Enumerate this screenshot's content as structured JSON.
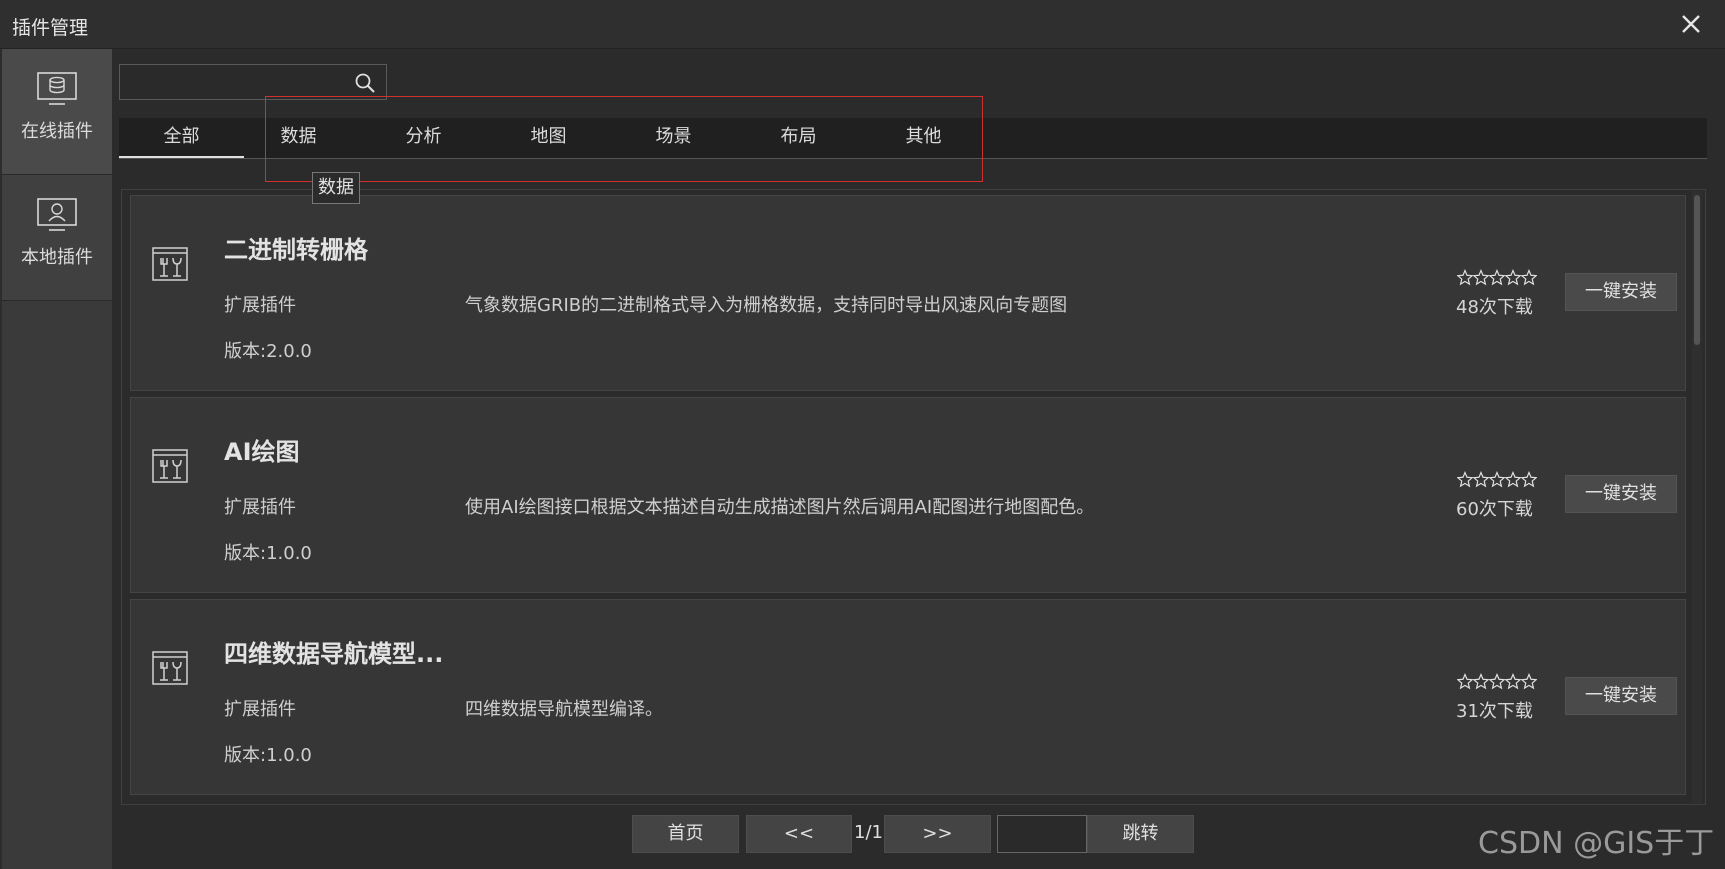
{
  "window": {
    "title": "插件管理",
    "close_icon": "close-icon"
  },
  "sidebar": {
    "items": [
      {
        "label": "在线插件",
        "icon": "database-monitor-icon",
        "active": true
      },
      {
        "label": "本地插件",
        "icon": "monitor-user-icon",
        "active": false
      }
    ]
  },
  "search": {
    "value": "",
    "placeholder": "",
    "icon": "search-icon"
  },
  "tabs": {
    "items": [
      {
        "label": "全部",
        "active": true
      },
      {
        "label": "数据",
        "active": false
      },
      {
        "label": "分析",
        "active": false
      },
      {
        "label": "地图",
        "active": false
      },
      {
        "label": "场景",
        "active": false
      },
      {
        "label": "布局",
        "active": false
      },
      {
        "label": "其他",
        "active": false
      }
    ],
    "tooltip": "数据"
  },
  "plugins": [
    {
      "name": "二进制转栅格",
      "category": "扩展插件",
      "description": "气象数据GRIB的二进制格式导入为栅格数据，支持同时导出风速风向专题图",
      "version": "版本:2.0.0",
      "rating": 0,
      "rating_max": 5,
      "downloads": "48次下载",
      "install_label": "一键安装"
    },
    {
      "name": "AI绘图",
      "category": "扩展插件",
      "description": "使用AI绘图接口根据文本描述自动生成描述图片然后调用AI配图进行地图配色。",
      "version": "版本:1.0.0",
      "rating": 0,
      "rating_max": 5,
      "downloads": "60次下载",
      "install_label": "一键安装"
    },
    {
      "name": "四维数据导航模型...",
      "category": "扩展插件",
      "description": "四维数据导航模型编译。",
      "version": "版本:1.0.0",
      "rating": 0,
      "rating_max": 5,
      "downloads": "31次下载",
      "install_label": "一键安装"
    }
  ],
  "pagination": {
    "first": "首页",
    "prev": "<<",
    "indicator": "1/1",
    "next": ">>",
    "jump_value": "",
    "jump": "跳转"
  },
  "watermark": "CSDN @GIS于丁",
  "colors": {
    "highlight_border": "#d13030",
    "background": "#2b2b2b",
    "card": "#363636"
  }
}
